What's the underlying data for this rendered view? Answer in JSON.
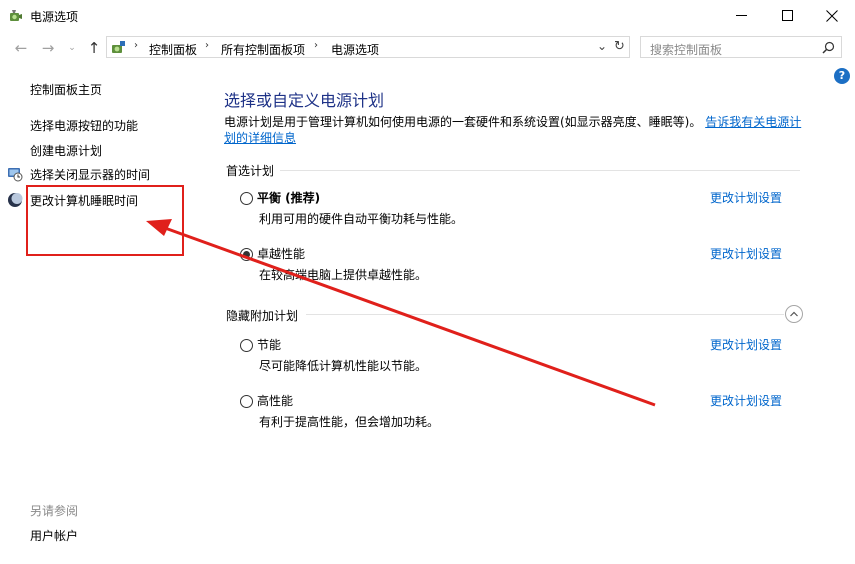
{
  "window": {
    "title": "电源选项",
    "app_icon": "power-options-icon",
    "controls": [
      "minimize-icon",
      "maximize-icon",
      "close-icon"
    ]
  },
  "address_bar": {
    "breadcrumbs": [
      "控制面板",
      "所有控制面板项",
      "电源选项"
    ],
    "search_placeholder": "搜索控制面板"
  },
  "sidebar": {
    "home": "控制面板主页",
    "links": [
      {
        "label": "选择电源按钮的功能",
        "icon": null
      },
      {
        "label": "创建电源计划",
        "icon": null
      },
      {
        "label": "选择关闭显示器的时间",
        "icon": "display-power-icon"
      },
      {
        "label": "更改计算机睡眠时间",
        "icon": "moon-icon"
      }
    ],
    "see_also_title": "另请参阅",
    "see_also_links": [
      "用户帐户"
    ]
  },
  "main": {
    "heading": "选择或自定义电源计划",
    "description": "电源计划是用于管理计算机如何使用电源的一套硬件和系统设置(如显示器亮度、睡眠等)。",
    "description_link": "告诉我有关电源计划的详细信息",
    "preferred_section": "首选计划",
    "hidden_section": "隐藏附加计划",
    "change_link": "更改计划设置",
    "preferred_plans": [
      {
        "name": "平衡 (推荐)",
        "desc": "利用可用的硬件自动平衡功耗与性能。",
        "selected": false
      },
      {
        "name": "卓越性能",
        "desc": "在较高端电脑上提供卓越性能。",
        "selected": true
      }
    ],
    "hidden_plans": [
      {
        "name": "节能",
        "desc": "尽可能降低计算机性能以节能。",
        "selected": false
      },
      {
        "name": "高性能",
        "desc": "有利于提高性能，但会增加功耗。",
        "selected": false
      }
    ]
  },
  "annotation": {
    "color": "#e0201b"
  }
}
